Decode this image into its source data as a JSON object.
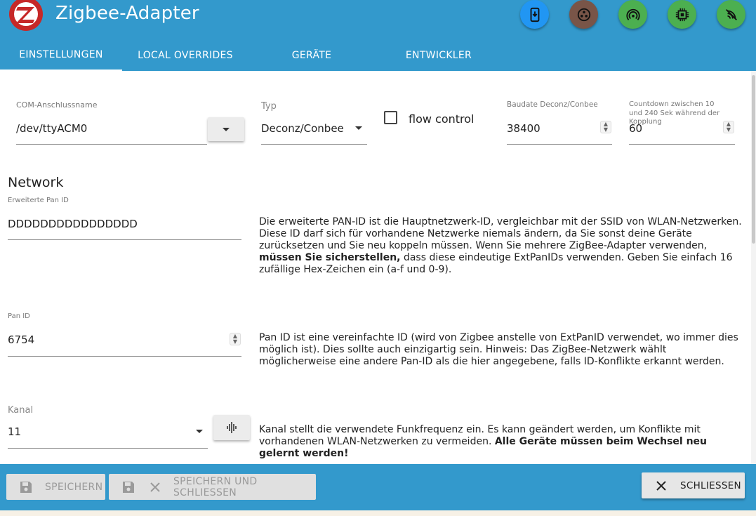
{
  "header": {
    "title": "Zigbee-Adapter",
    "buttons": [
      {
        "icon": "mobile-download-icon",
        "color": "#2196f3"
      },
      {
        "icon": "zigbee-dots-icon",
        "color": "#795548"
      },
      {
        "icon": "wireless-signal-icon",
        "color": "#4caf50"
      },
      {
        "icon": "chip-icon",
        "color": "#4caf50"
      },
      {
        "icon": "signal-scan-icon",
        "color": "#4caf50"
      }
    ]
  },
  "tabs": [
    {
      "label": "EINSTELLUNGEN",
      "active": true
    },
    {
      "label": "LOCAL OVERRIDES",
      "active": false
    },
    {
      "label": "GERÄTE",
      "active": false
    },
    {
      "label": "ENTWICKLER",
      "active": false
    }
  ],
  "com": {
    "label": "COM-Anschlussname",
    "value": "/dev/ttyACM0"
  },
  "typ": {
    "label": "Typ",
    "value": "Deconz/Conbee"
  },
  "flow": {
    "label": "flow control",
    "checked": false
  },
  "baud": {
    "label": "Baudate Deconz/Conbee",
    "value": "38400"
  },
  "countdown": {
    "label": "Countdown zwischen 10 und 240 Sek während der Kopplung",
    "value": "60"
  },
  "network": {
    "title": "Network",
    "ext_pan": {
      "label": "Erweiterte Pan ID",
      "value": "DDDDDDDDDDDDDDDD",
      "desc_1": "Die erweiterte PAN-ID ist die Hauptnetzwerk-ID, vergleichbar mit der SSID von WLAN-Netzwerken. Diese ID darf sich für vorhandene Netzwerke niemals ändern, da Sie sonst deine Geräte zurücksetzen und Sie neu koppeln müssen. Wenn Sie mehrere ZigBee-Adapter verwenden, ",
      "desc_bold": "müssen Sie sicherstellen,",
      "desc_2": " dass diese eindeutige ExtPanIDs verwenden. Geben Sie einfach 16 zufällige Hex-Zeichen ein (a-f und 0-9)."
    },
    "pan": {
      "label": "Pan ID",
      "value": "6754",
      "desc": "Pan ID ist eine vereinfachte ID (wird von Zigbee anstelle von ExtPanID verwendet, wo immer dies möglich ist). Dies sollte auch einzigartig sein. Hinweis: Das ZigBee-Netzwerk wählt möglicherweise eine andere Pan-ID als die hier angegebene, falls ID-Konflikte erkannt werden."
    },
    "kanal": {
      "label": "Kanal",
      "value": "11",
      "desc_1": "Kanal stellt die verwendete Funkfrequenz ein. Es kann geändert werden, um Konflikte mit vorhandenen WLAN-Netzwerken zu vermeiden. ",
      "desc_bold": "Alle Geräte müssen beim Wechsel neu gelernt werden!"
    }
  },
  "footer": {
    "save": "SPEICHERN",
    "save_close": "SPEICHERN UND SCHLIESSEN",
    "close": "SCHLIESSEN"
  }
}
